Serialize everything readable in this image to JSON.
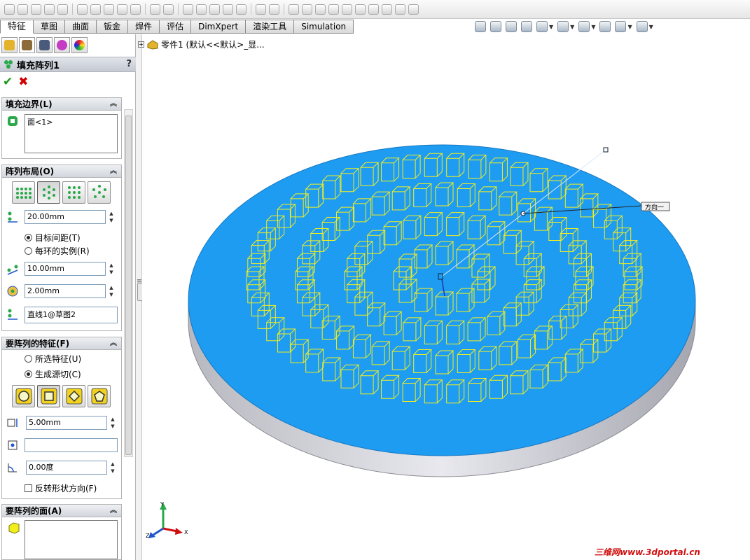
{
  "tabs": [
    "特征",
    "草图",
    "曲面",
    "钣金",
    "焊件",
    "评估",
    "DimXpert",
    "渲染工具",
    "Simulation"
  ],
  "active_tab": "特征",
  "property_manager": {
    "title": "填充阵列1",
    "help": "?",
    "ok": "✔",
    "cancel": "✖",
    "fill_boundary": {
      "header": "填充边界(L)",
      "selection": "面<1>"
    },
    "pattern_layout": {
      "header": "阵列布局(O)",
      "spacing": "20.00mm",
      "radio_target_spacing": "目标间距(T)",
      "radio_instances_per_ring": "每环的实例(R)",
      "instance_spacing": "10.00mm",
      "margin": "2.00mm",
      "direction": "直线1@草图2"
    },
    "features_to_pattern": {
      "header": "要阵列的特征(F)",
      "radio_selected": "所选特征(U)",
      "radio_generate_seed": "生成源切(C)",
      "size": "5.00mm",
      "vertex": "",
      "rotation": "0.00度",
      "flip_label": "反转形状方向(F)"
    },
    "faces_to_pattern": {
      "header": "要阵列的面(A)"
    }
  },
  "tree": {
    "expand": "+",
    "label": "零件1 (默认<<默认>_显..."
  },
  "viewport": {
    "direction_label": "方向一",
    "triad": {
      "x": "X",
      "y": "Y",
      "z": "Z"
    }
  },
  "watermark": "三维网www.3dportal.cn",
  "colors": {
    "face": "#1e9cf2",
    "preview": "#f2ee1e",
    "ok": "#1a9a1a",
    "cancel": "#d00000"
  }
}
